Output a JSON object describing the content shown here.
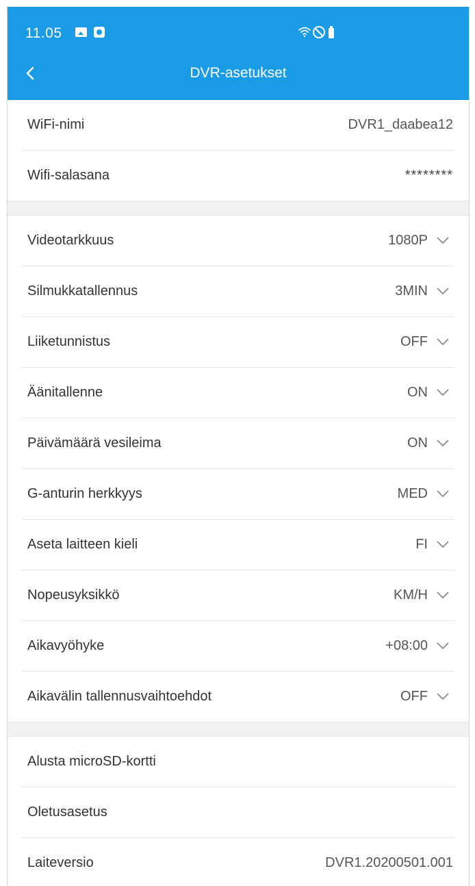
{
  "status_bar": {
    "time": "11.05",
    "icons": [
      "image-icon",
      "notification-icon",
      "wifi-icon",
      "do-not-disturb-icon",
      "battery-icon"
    ]
  },
  "header": {
    "title": "DVR-asetukset",
    "back_icon": "chevron-left-icon",
    "background": "#1a9be6"
  },
  "wifi": {
    "name_label": "WiFi-nimi",
    "name_value": "DVR1_daabea12",
    "password_label": "Wifi-salasana",
    "password_value": "********"
  },
  "settings": [
    {
      "label": "Videotarkkuus",
      "value": "1080P"
    },
    {
      "label": "Silmukkatallennus",
      "value": "3MIN"
    },
    {
      "label": "Liiketunnistus",
      "value": "OFF"
    },
    {
      "label": "Äänitallenne",
      "value": "ON"
    },
    {
      "label": "Päivämäärä vesileima",
      "value": "ON"
    },
    {
      "label": "G-anturin herkkyys",
      "value": "MED"
    },
    {
      "label": "Aseta laitteen kieli",
      "value": "FI"
    },
    {
      "label": "Nopeusyksikkö",
      "value": "KM/H"
    },
    {
      "label": "Aikavyöhyke",
      "value": "+08:00"
    },
    {
      "label": "Aikavälin tallennusvaihtoehdot",
      "value": "OFF"
    }
  ],
  "actions": {
    "format_label": "Alusta microSD-kortti",
    "default_label": "Oletusasetus",
    "version_label": "Laiteversio",
    "version_value": "DVR1.20200501.001"
  }
}
